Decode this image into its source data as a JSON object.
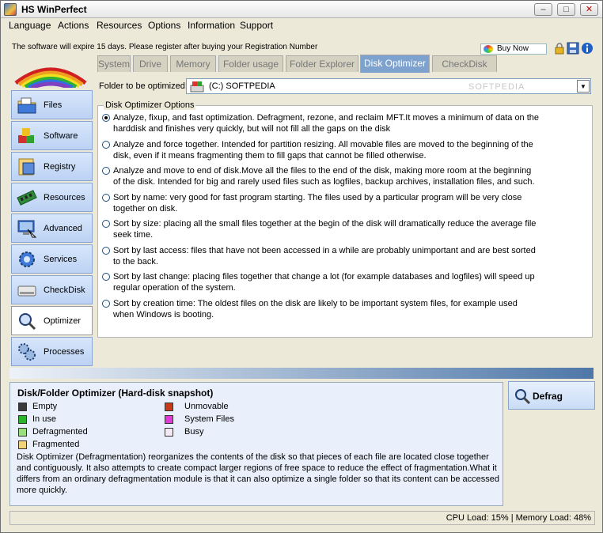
{
  "window": {
    "title": "HS WinPerfect"
  },
  "menu": [
    "Language",
    "Actions",
    "Resources",
    "Options",
    "Information",
    "Support"
  ],
  "notice": "The software will expire 15 days. Please register after buying your Registration Number",
  "buy_now": "Buy Now",
  "sidebar": [
    {
      "label": "Files",
      "icon": "files-icon"
    },
    {
      "label": "Software",
      "icon": "software-icon"
    },
    {
      "label": "Registry",
      "icon": "registry-icon"
    },
    {
      "label": "Resources",
      "icon": "resources-icon"
    },
    {
      "label": "Advanced",
      "icon": "advanced-icon"
    },
    {
      "label": "Services",
      "icon": "services-icon"
    },
    {
      "label": "CheckDisk",
      "icon": "checkdisk-icon"
    },
    {
      "label": "Optimizer",
      "icon": "optimizer-icon"
    },
    {
      "label": "Processes",
      "icon": "processes-icon"
    }
  ],
  "tabs": [
    "System",
    "Drive",
    "Memory",
    "Folder usage",
    "Folder Explorer",
    "Disk Optimizer",
    "CheckDisk"
  ],
  "folder": {
    "label": "Folder to be optimized:",
    "value": "(C:) SOFTPEDIA",
    "watermark": "SOFTPEDIA"
  },
  "options_title": "Disk Optimizer Options",
  "options": [
    "Analyze, fixup, and fast optimization. Defragment, rezone, and reclaim MFT.It moves a minimum of data on the harddisk and finishes very quickly, but will not fill all the gaps on the disk",
    "Analyze and force together. Intended for partition resizing. All movable files are moved to the beginning of the disk, even if it means fragmenting them to fill gaps that cannot be filled otherwise.",
    "Analyze and move to end of disk.Move all the files to the end of the disk, making more room at the beginning of the disk. Intended for big and rarely used files such as logfiles, backup archives, installation files, and such.",
    "Sort by name: very good for fast program starting. The files used by a particular program will be very close together on disk.",
    "Sort by size: placing all the small files together at the begin of the disk will dramatically reduce the average file seek time.",
    "Sort by last access: files that have not been accessed in a while are probably unimportant and are best sorted to the back.",
    "Sort by last change: placing files together that change a lot (for example databases and logfiles) will speed up regular operation of the system.",
    "Sort by creation time: The oldest files on the disk are likely to be important system files, for example used when Windows is booting."
  ],
  "info": {
    "title": "Disk/Folder Optimizer (Hard-disk snapshot)",
    "legend_left": [
      {
        "label": "Empty",
        "color": "#3a3a3a"
      },
      {
        "label": "In use",
        "color": "#2cb52c"
      },
      {
        "label": "Defragmented",
        "color": "#9be07e"
      },
      {
        "label": "Fragmented",
        "color": "#f3d37a"
      }
    ],
    "legend_right": [
      {
        "label": "Unmovable",
        "color": "#c83a1a"
      },
      {
        "label": "System Files",
        "color": "#e23ad8"
      },
      {
        "label": "Busy",
        "color": "#f4eaf6"
      }
    ],
    "description": "Disk Optimizer (Defragmentation) reorganizes the contents of the disk so that pieces of each file are located close together and contiguously. It also attempts to create compact larger regions of free space to reduce the effect of fragmentation.What it differs from an ordinary defragmentation module is that it can also optimize a single folder so that its content can be accessed more quickly."
  },
  "defrag_label": "Defrag",
  "status": "CPU Load: 15%  |  Memory Load: 48%"
}
